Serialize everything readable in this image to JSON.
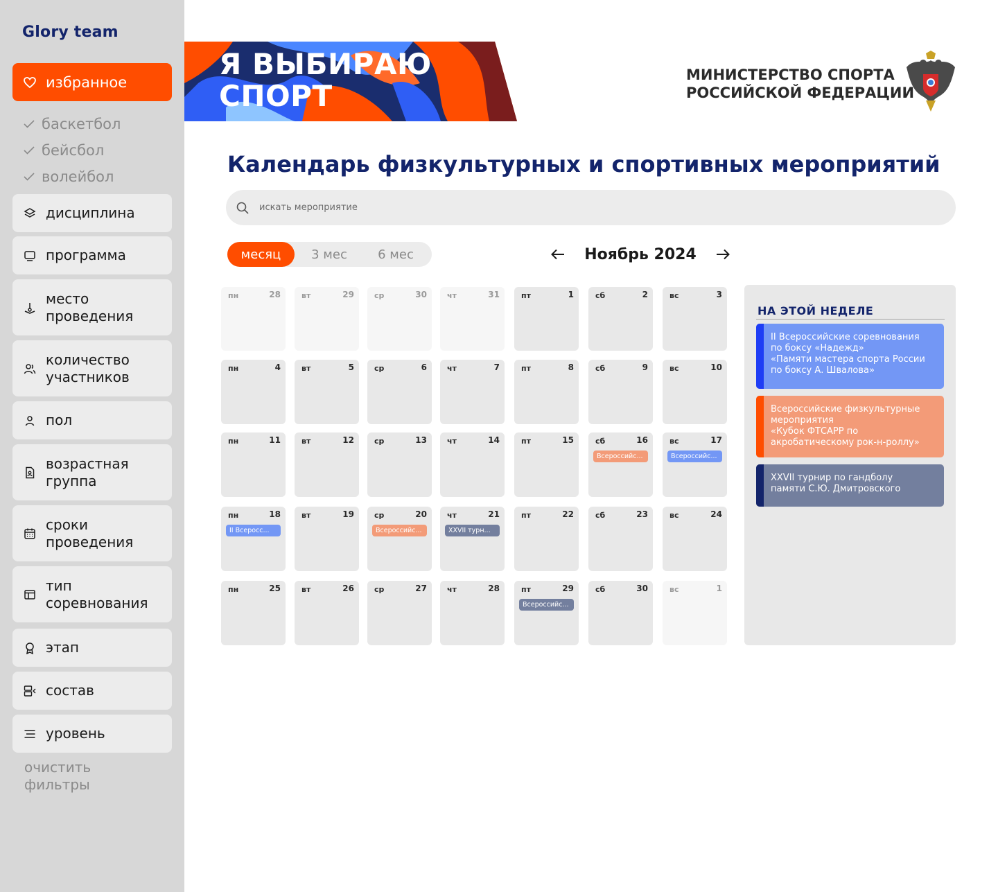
{
  "app": {
    "brand": "Glory team"
  },
  "sidebar": {
    "favorites_label": "избранное",
    "favorites": [
      "баскетбол",
      "бейсбол",
      "волейбол"
    ],
    "filters": [
      {
        "label": "дисциплина",
        "icon": "layers-icon"
      },
      {
        "label": "программа",
        "icon": "monitor-icon"
      },
      {
        "label": "место\nпроведения",
        "icon": "location-icon"
      },
      {
        "label": "количество\nучастников",
        "icon": "users-icon"
      },
      {
        "label": "пол",
        "icon": "user-icon"
      },
      {
        "label": "возрастная\nгруппа",
        "icon": "document-user-icon"
      },
      {
        "label": "сроки\nпроведения",
        "icon": "calendar-icon"
      },
      {
        "label": "тип\nсоревнования",
        "icon": "window-icon"
      },
      {
        "label": "этап",
        "icon": "award-icon"
      },
      {
        "label": "состав",
        "icon": "roster-icon"
      },
      {
        "label": "уровень",
        "icon": "menu-lines-icon"
      }
    ],
    "clear_label": "очистить\nфильтры"
  },
  "header": {
    "banner_text": "Я ВЫБИРАЮ\nСПОРТ",
    "ministry": "МИНИСТЕРСТВО СПОРТА\nРОССИЙСКОЙ ФЕДЕРАЦИИ"
  },
  "main": {
    "title": "Календарь физкультурных и спортивных мероприятий",
    "search_placeholder": "искать мероприятие",
    "tabs": [
      "месяц",
      "3 мес",
      "6 мес"
    ],
    "month_label": "Ноябрь 2024"
  },
  "colors": {
    "accent": "#ff4d00",
    "navy": "#13246b",
    "blue_event": "#7397f5",
    "orange_event": "#f39b78",
    "slate_event": "#737f9e"
  },
  "calendar": {
    "rows": [
      [
        {
          "dn": "пн",
          "d": "28",
          "other": true
        },
        {
          "dn": "вт",
          "d": "29",
          "other": true
        },
        {
          "dn": "ср",
          "d": "30",
          "other": true
        },
        {
          "dn": "чт",
          "d": "31",
          "other": true
        },
        {
          "dn": "пт",
          "d": "1"
        },
        {
          "dn": "сб",
          "d": "2"
        },
        {
          "dn": "вс",
          "d": "3"
        }
      ],
      [
        {
          "dn": "пн",
          "d": "4"
        },
        {
          "dn": "вт",
          "d": "5"
        },
        {
          "dn": "ср",
          "d": "6"
        },
        {
          "dn": "чт",
          "d": "7"
        },
        {
          "dn": "пт",
          "d": "8"
        },
        {
          "dn": "сб",
          "d": "9"
        },
        {
          "dn": "вс",
          "d": "10"
        }
      ],
      [
        {
          "dn": "пн",
          "d": "11"
        },
        {
          "dn": "вт",
          "d": "12"
        },
        {
          "dn": "ср",
          "d": "13"
        },
        {
          "dn": "чт",
          "d": "14"
        },
        {
          "dn": "пт",
          "d": "15"
        },
        {
          "dn": "сб",
          "d": "16",
          "event": {
            "text": "Всероссийс...",
            "color": "#f39b78"
          }
        },
        {
          "dn": "вс",
          "d": "17",
          "event": {
            "text": "Всероссийс...",
            "color": "#7397f5"
          }
        }
      ],
      [
        {
          "dn": "пн",
          "d": "18",
          "event": {
            "text": "II  Всеросс...",
            "color": "#7397f5"
          }
        },
        {
          "dn": "вт",
          "d": "19"
        },
        {
          "dn": "ср",
          "d": "20",
          "event": {
            "text": "Всероссийс...",
            "color": "#f39b78"
          }
        },
        {
          "dn": "чт",
          "d": "21",
          "event": {
            "text": "XXVII  турн...",
            "color": "#737f9e"
          }
        },
        {
          "dn": "пт",
          "d": "22"
        },
        {
          "dn": "сб",
          "d": "23"
        },
        {
          "dn": "вс",
          "d": "24"
        }
      ],
      [
        {
          "dn": "пн",
          "d": "25"
        },
        {
          "dn": "вт",
          "d": "26"
        },
        {
          "dn": "ср",
          "d": "27"
        },
        {
          "dn": "чт",
          "d": "28"
        },
        {
          "dn": "пт",
          "d": "29",
          "event": {
            "text": "Всероссийс...",
            "color": "#737f9e"
          }
        },
        {
          "dn": "сб",
          "d": "30"
        },
        {
          "dn": "вс",
          "d": "1",
          "other": true
        }
      ]
    ]
  },
  "week": {
    "title": "НА ЭТОЙ НЕДЕЛЕ",
    "events": [
      {
        "text": "II  Всероссийские соревнования\nпо боксу «Надежд»\n«Памяти мастера спорта России\nпо боксу А. Швалова»",
        "color": "#7397f5",
        "bar": "#1e3df5"
      },
      {
        "text": "Всероссийские физкультурные\nмероприятия\n«Кубок ФТСАРР по\nакробатическому  рок-н-роллу»",
        "color": "#f39b78",
        "bar": "#ff4d00"
      },
      {
        "text": "XXVII  турнир по гандболу\nпамяти С.Ю. Дмитровского",
        "color": "#737f9e",
        "bar": "#13246b"
      }
    ]
  }
}
